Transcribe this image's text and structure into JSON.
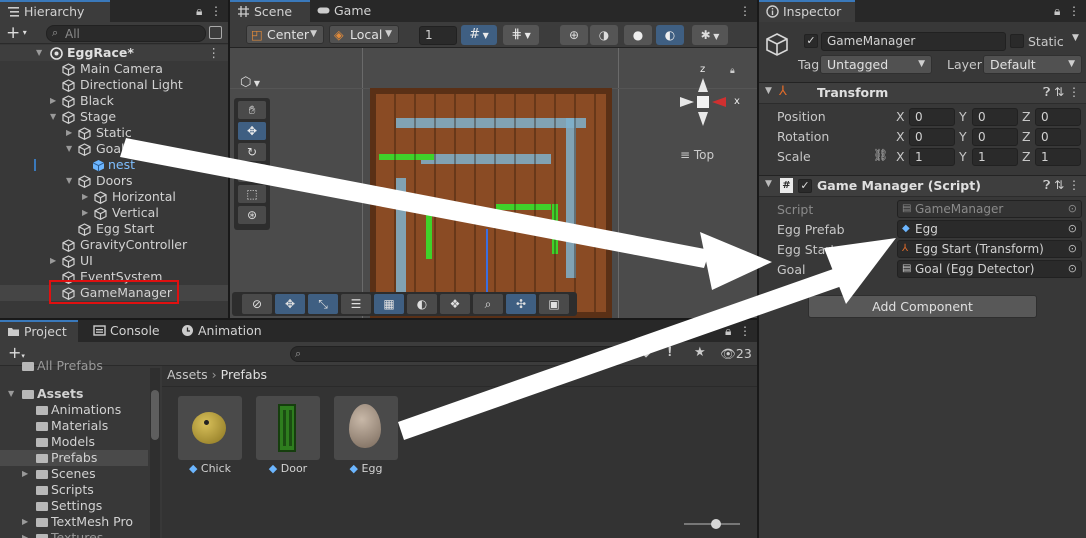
{
  "hierarchy": {
    "tab": "Hierarchy",
    "search_placeholder": "All",
    "scene_name": "EggRace*",
    "items": [
      {
        "label": "Main Camera"
      },
      {
        "label": "Directional Light"
      },
      {
        "label": "Black"
      },
      {
        "label": "Stage"
      },
      {
        "label": "Static"
      },
      {
        "label": "Goal"
      },
      {
        "label": "nest"
      },
      {
        "label": "Doors"
      },
      {
        "label": "Horizontal"
      },
      {
        "label": "Vertical"
      },
      {
        "label": "Egg Start"
      },
      {
        "label": "GravityController"
      },
      {
        "label": "UI"
      },
      {
        "label": "EventSystem"
      },
      {
        "label": "GameManager"
      }
    ]
  },
  "scene": {
    "tabs": [
      "Scene",
      "Game"
    ],
    "pivot": "Center",
    "space": "Local",
    "grid_size": "1",
    "view_label": "Top",
    "gizmo_axes": {
      "z": "z",
      "x": "x"
    }
  },
  "project": {
    "tabs": [
      "Project",
      "Console",
      "Animation"
    ],
    "count": "23",
    "folders": [
      {
        "label": "All Prefabs"
      },
      {
        "label": "Assets"
      },
      {
        "label": "Animations"
      },
      {
        "label": "Materials"
      },
      {
        "label": "Models"
      },
      {
        "label": "Prefabs"
      },
      {
        "label": "Scenes"
      },
      {
        "label": "Scripts"
      },
      {
        "label": "Settings"
      },
      {
        "label": "TextMesh Pro"
      },
      {
        "label": "Textures"
      }
    ],
    "breadcrumb": [
      "Assets",
      "Prefabs"
    ],
    "assets": [
      {
        "label": "Chick"
      },
      {
        "label": "Door"
      },
      {
        "label": "Egg"
      }
    ]
  },
  "inspector": {
    "tab": "Inspector",
    "object_name": "GameManager",
    "static_label": "Static",
    "tag_label": "Tag",
    "tag_value": "Untagged",
    "layer_label": "Layer",
    "layer_value": "Default",
    "transform": {
      "title": "Transform",
      "rows": [
        {
          "label": "Position",
          "x": "0",
          "y": "0",
          "z": "0"
        },
        {
          "label": "Rotation",
          "x": "0",
          "y": "0",
          "z": "0"
        },
        {
          "label": "Scale",
          "x": "1",
          "y": "1",
          "z": "1"
        }
      ],
      "axes": [
        "X",
        "Y",
        "Z"
      ]
    },
    "script_component": {
      "title": "Game Manager (Script)",
      "script_label": "Script",
      "script_value": "GameManager",
      "fields": [
        {
          "label": "Egg Prefab",
          "value": "Egg"
        },
        {
          "label": "Egg Start",
          "value": "Egg Start (Transform)"
        },
        {
          "label": "Goal",
          "value": "Goal (Egg Detector)"
        }
      ]
    },
    "add_component": "Add Component"
  },
  "colors": {
    "accent_blue": "#3a79bb",
    "highlight_red": "#e01010",
    "arrow_white": "#ffffff",
    "prefab_blue": "#6cb6ff"
  }
}
